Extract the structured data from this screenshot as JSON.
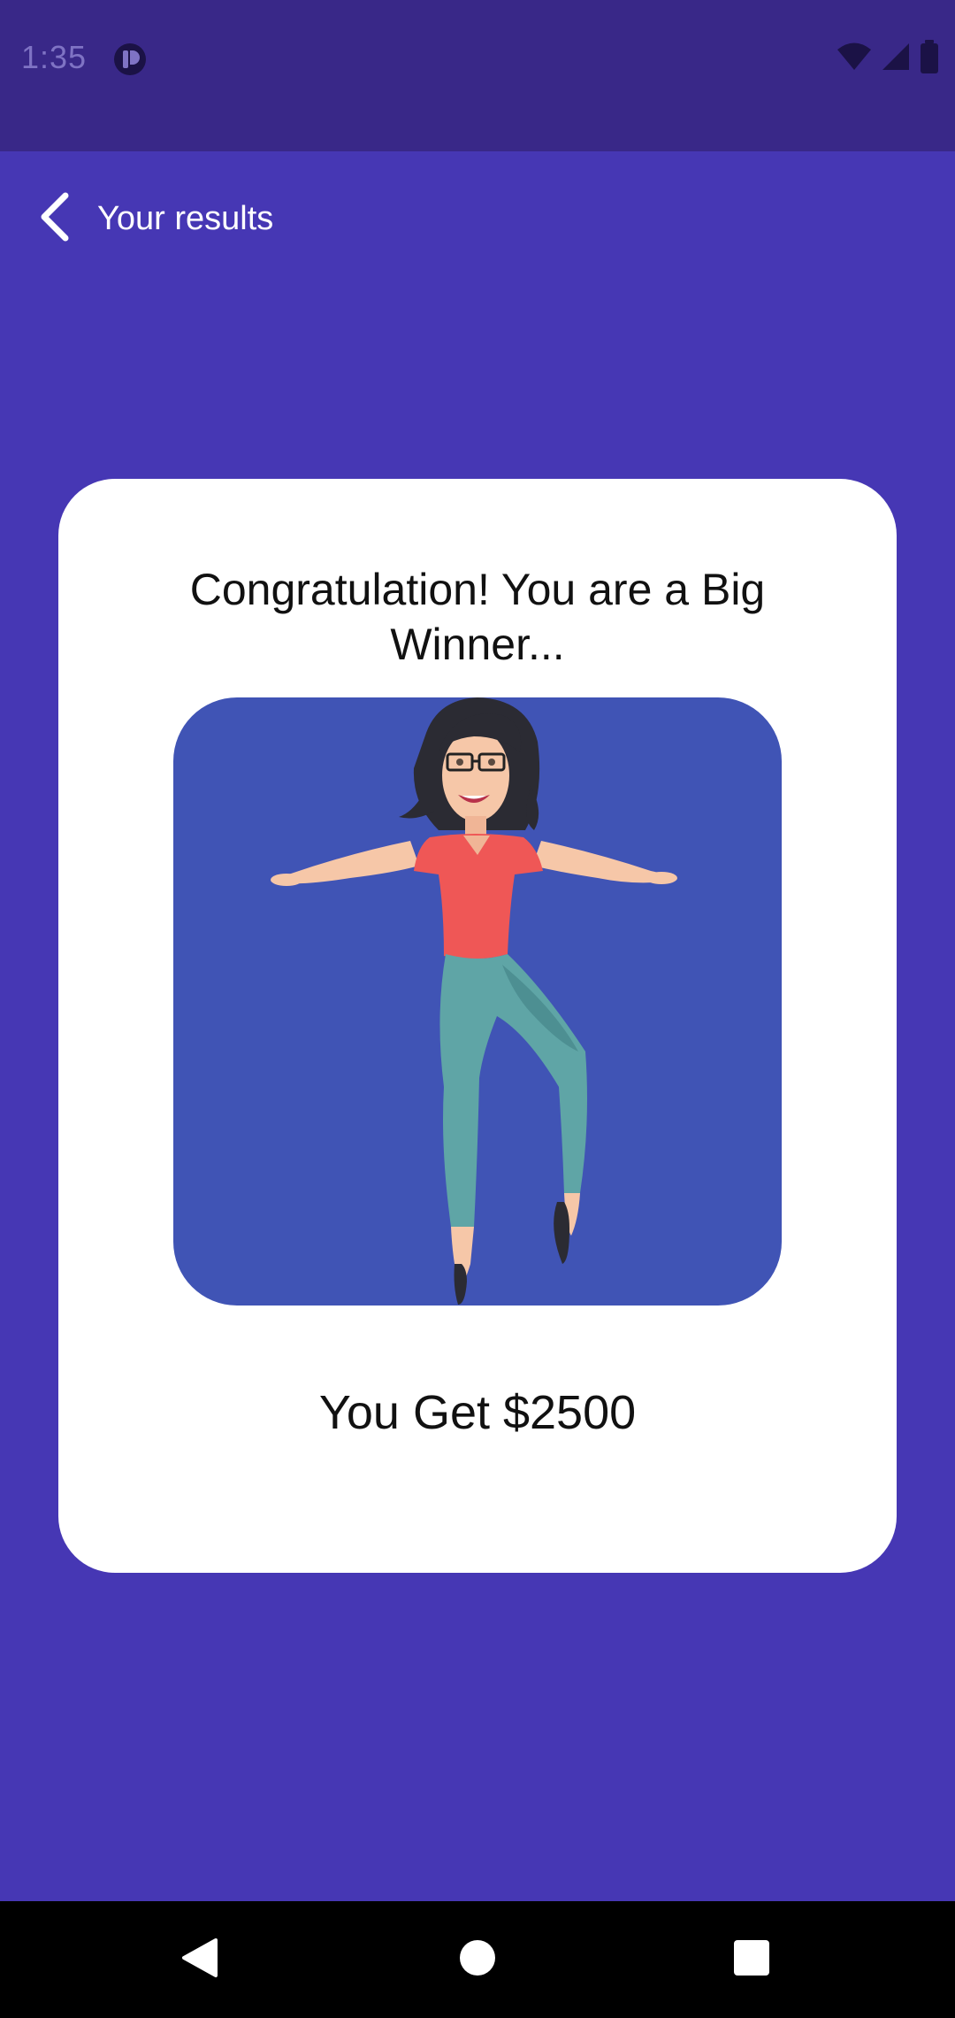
{
  "status_bar": {
    "time": "1:35",
    "icons": [
      "app-notification-icon",
      "wifi-icon",
      "cellular-signal-icon",
      "battery-icon"
    ]
  },
  "app_bar": {
    "title": "Your results",
    "back_icon": "chevron-left-icon"
  },
  "result_card": {
    "headline": "Congratulation! You are a Big Winner...",
    "illustration": "dancing-woman-illustration",
    "prize_text": "You Get $2500"
  },
  "navigation_bar": {
    "buttons": [
      "back-triangle-icon",
      "home-circle-icon",
      "recents-square-icon"
    ]
  },
  "colors": {
    "status_bar": "#392888",
    "background": "#4637b4",
    "card": "#ffffff",
    "illustration_bg": "#4054b5",
    "nav_bar": "#000000"
  }
}
